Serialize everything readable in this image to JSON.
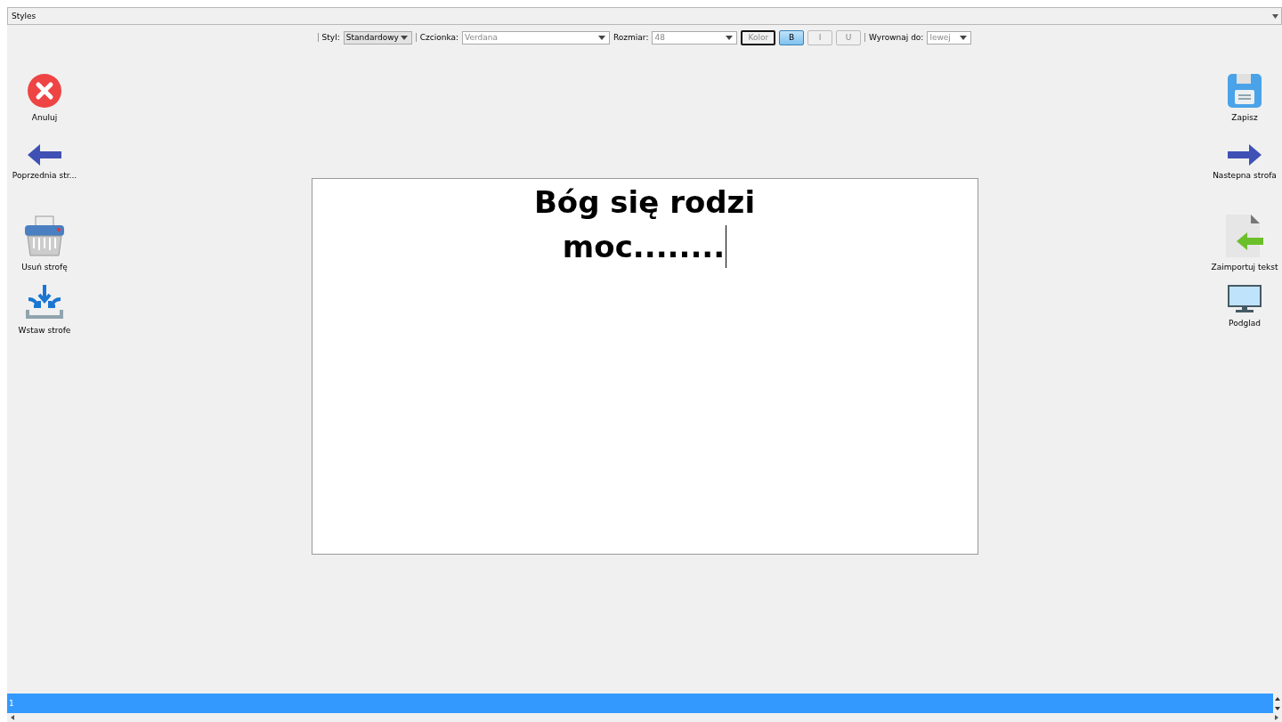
{
  "panel": {
    "title": "Styles"
  },
  "toolbar": {
    "style": {
      "label": "Styl:",
      "value": "Standardowy"
    },
    "font": {
      "label": "Czcionka:",
      "value": "Verdana"
    },
    "size": {
      "label": "Rozmiar:",
      "value": "48"
    },
    "buttons": [
      {
        "label": "Kolor",
        "kind": "color",
        "selected": false
      },
      {
        "label": "B",
        "kind": "bold",
        "selected": true
      },
      {
        "label": "I",
        "kind": "italic",
        "selected": false
      },
      {
        "label": "U",
        "kind": "underline",
        "selected": false
      }
    ],
    "align": {
      "label": "Wyrownaj do:",
      "value": "lewej"
    }
  },
  "left_actions": [
    {
      "label": "Anuluj",
      "kind": "cancel"
    },
    {
      "label": "Poprzednia str...",
      "kind": "prev"
    },
    {
      "label": "Usuń strofę",
      "kind": "delete"
    },
    {
      "label": "Wstaw strofe",
      "kind": "insert"
    }
  ],
  "right_actions": [
    {
      "label": "Zapisz",
      "kind": "save"
    },
    {
      "label": "Nastepna strofa",
      "kind": "next"
    },
    {
      "label": "Zaimportuj tekst",
      "kind": "import"
    },
    {
      "label": "Podglad",
      "kind": "preview"
    }
  ],
  "editor": {
    "lines": [
      "Bóg się rodzi",
      "moc........"
    ]
  },
  "stanza_list": [
    {
      "label": "1",
      "selected": true
    }
  ]
}
